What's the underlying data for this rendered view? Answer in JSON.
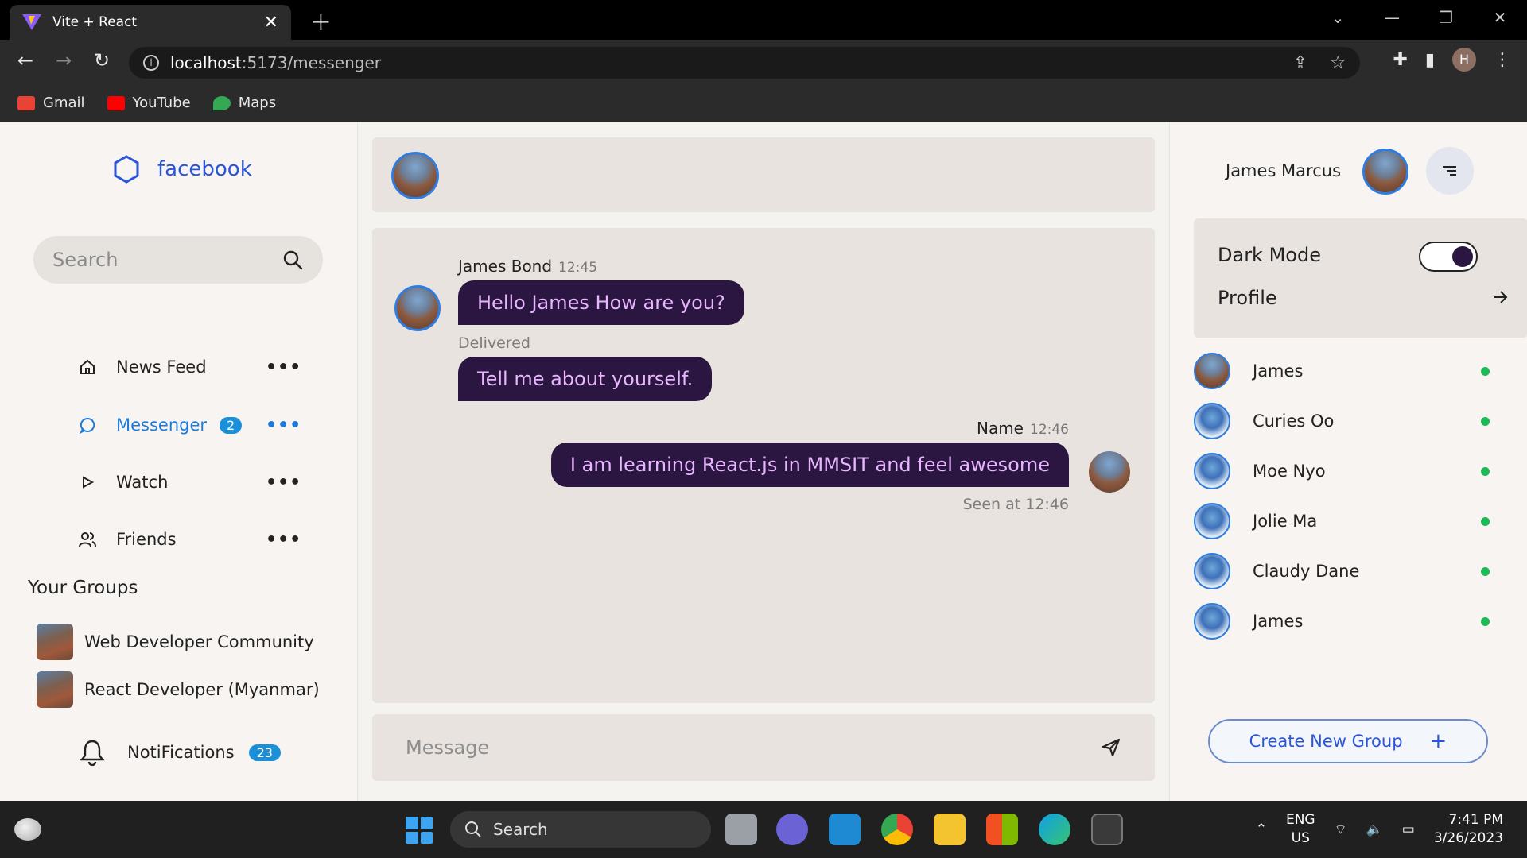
{
  "browser": {
    "tab_title": "Vite + React",
    "tab_close": "✕",
    "new_tab": "+",
    "url_host": "localhost",
    "url_path": ":5173/messenger",
    "bookmarks": [
      {
        "label": "Gmail",
        "color": "#ea4335"
      },
      {
        "label": "YouTube",
        "color": "#ff0000"
      },
      {
        "label": "Maps",
        "color": "#34a853"
      }
    ],
    "profile_initial": "H"
  },
  "sidebar": {
    "brand": "facebook",
    "search_placeholder": "Search",
    "menu": [
      {
        "label": "News Feed",
        "icon": "home-icon"
      },
      {
        "label": "Messenger",
        "icon": "chat-icon",
        "badge": "2",
        "active": true
      },
      {
        "label": "Watch",
        "icon": "play-icon"
      },
      {
        "label": "Friends",
        "icon": "friends-icon"
      }
    ],
    "more_dots": "•••",
    "groups_title": "Your Groups",
    "groups": [
      {
        "name": "Web Developer Community"
      },
      {
        "name": "React Developer (Myanmar)"
      }
    ],
    "notifications_label": "NotiFications",
    "notifications_count": "23"
  },
  "chat": {
    "messages": [
      {
        "sender": "James Bond",
        "time": "12:45",
        "text": "Hello James How are you?",
        "direction": "in"
      },
      {
        "status": "Delivered"
      },
      {
        "text": "Tell me about yourself.",
        "direction": "in"
      },
      {
        "sender": "Name",
        "time": "12:46",
        "text": "I am learning React.js in MMSIT and feel awesome",
        "direction": "out",
        "status": "Seen at 12:46"
      }
    ],
    "composer_placeholder": "Message"
  },
  "right_panel": {
    "user_name": "James Marcus",
    "settings": {
      "dark_mode_label": "Dark Mode",
      "dark_mode_on": true,
      "profile_label": "Profile"
    },
    "contacts": [
      {
        "name": "James",
        "avatar": "building",
        "online": true
      },
      {
        "name": "Curies Oo",
        "avatar": "person",
        "online": true
      },
      {
        "name": "Moe Nyo",
        "avatar": "person",
        "online": true
      },
      {
        "name": "Jolie Ma",
        "avatar": "person",
        "online": true
      },
      {
        "name": "Claudy Dane",
        "avatar": "person",
        "online": true
      },
      {
        "name": "James",
        "avatar": "person",
        "online": true
      }
    ],
    "create_group_label": "Create New Group",
    "create_group_plus": "+"
  },
  "taskbar": {
    "search_label": "Search",
    "lang_line1": "ENG",
    "lang_line2": "US",
    "time": "7:41 PM",
    "date": "3/26/2023"
  },
  "colors": {
    "brand": "#2955d6",
    "bubble_bg": "#2a1640",
    "bubble_text": "#e8b6ff",
    "badge": "#1c8fd9",
    "online": "#1db954"
  }
}
